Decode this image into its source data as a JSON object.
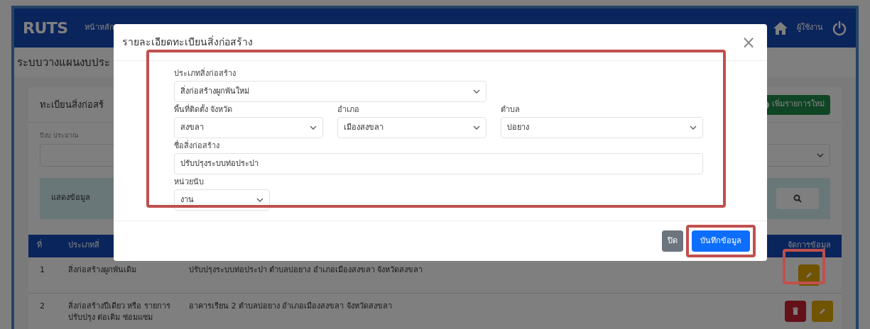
{
  "header": {
    "logo": "RUTS",
    "nav_item": "หน้าหลัก",
    "user": "ผู้ใช้งาน"
  },
  "breadcrumb": "ระบบวางแผนงบประ",
  "card": {
    "title": "ทะเบียนสิ่งก่อสร้",
    "add_button": "เพิ่มรายการใหม่",
    "filter_label": "ปีงบ ประมาณ",
    "search_button": "แสดงข้อมูล"
  },
  "table": {
    "columns": [
      "ที่",
      "ประเภทสิ่",
      "จัดการข้อมูล"
    ],
    "rows": [
      {
        "number": "1",
        "type": "สิ่งก่อสร้างผูกพันเดิม",
        "details": "ปรับปรุงระบบท่อประปา ตำบลบ่อยาง อำเภอเมืองสงขลา จังหวัดสงขลา",
        "actions": [
          {
            "kind": "edit"
          }
        ]
      },
      {
        "number": "2",
        "type": "สิ่งก่อสร้างปีเดียว หรือ รายการปรับปรุง ต่อเติม ซ่อมแซม",
        "details": "อาคารเรียน 2 ตำบลบ่อยาง อำเภอเมืองสงขลา จังหวัดสงขลา",
        "actions": [
          {
            "kind": "delete"
          },
          {
            "kind": "edit"
          }
        ]
      }
    ]
  },
  "modal": {
    "title": "รายละเอียดทะเบียนสิ่งก่อสร้าง",
    "close": "×",
    "field_rows": [
      [
        {
          "kind": "select",
          "label": "ประเภทสิ่งก่อสร้าง",
          "value": "สิ่งก่อสร้างผูกพันใหม่"
        }
      ],
      [
        {
          "kind": "select",
          "label": "พื้นที่ติดตั้ง จังหวัด",
          "value": "สงขลา"
        },
        {
          "kind": "select",
          "label": "อำเภอ",
          "value": "เมืองสงขลา"
        },
        {
          "kind": "select",
          "label": "ตำบล",
          "value": "บ่อยาง"
        }
      ],
      [
        {
          "kind": "input",
          "label": "ชื่อสิ่งก่อสร้าง",
          "value": "ปรับปรุงระบบท่อประปา"
        }
      ],
      [
        {
          "kind": "select",
          "label": "หน่วยนับ",
          "value": "งาน"
        }
      ]
    ],
    "buttons": [
      {
        "kind": "secondary",
        "label": "ปิด"
      },
      {
        "kind": "primary",
        "label": "บันทึกข้อมูล"
      }
    ]
  }
}
